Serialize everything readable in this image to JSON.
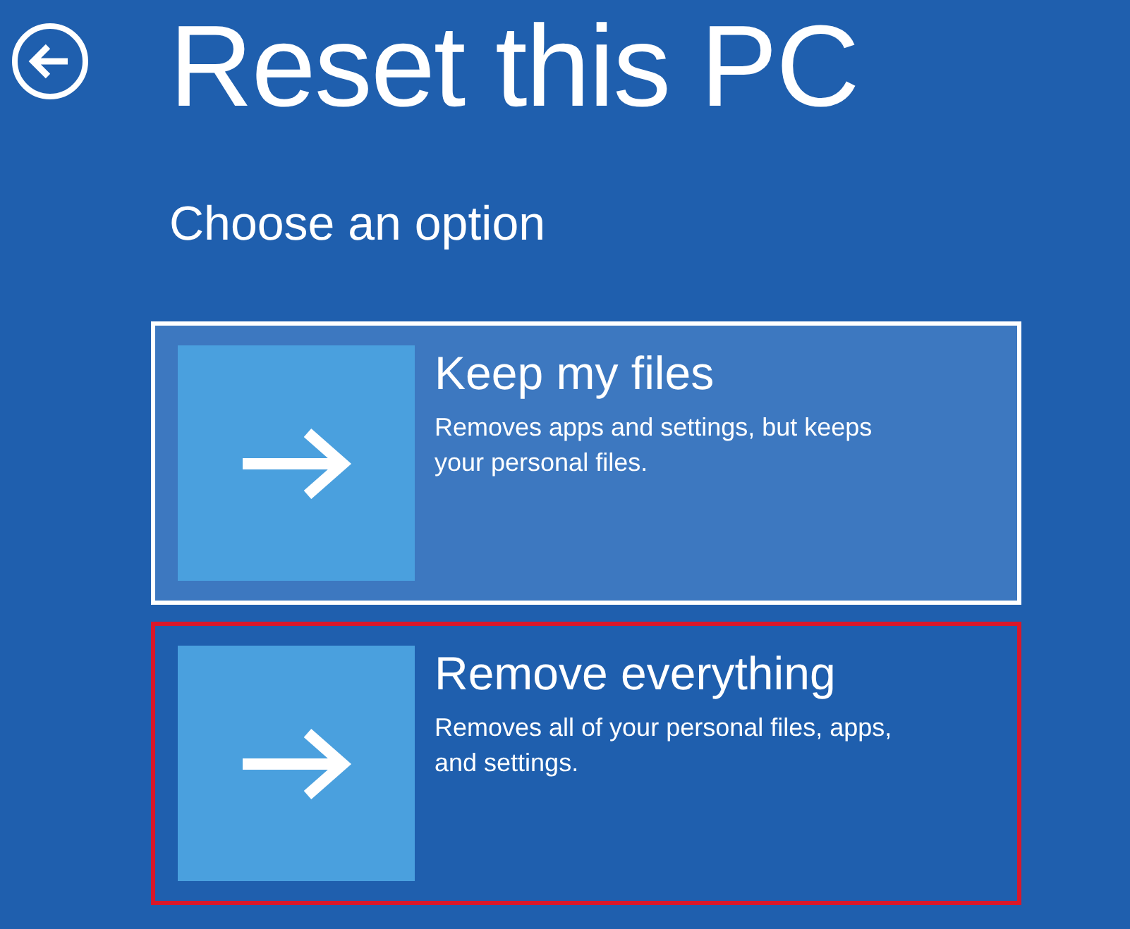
{
  "page": {
    "title": "Reset this PC",
    "subtitle": "Choose an option"
  },
  "options": [
    {
      "title": "Keep my files",
      "description": "Removes apps and settings, but keeps your personal files.",
      "selected": true,
      "highlighted": false
    },
    {
      "title": "Remove everything",
      "description": "Removes all of your personal files, apps, and settings.",
      "selected": false,
      "highlighted": true
    }
  ]
}
